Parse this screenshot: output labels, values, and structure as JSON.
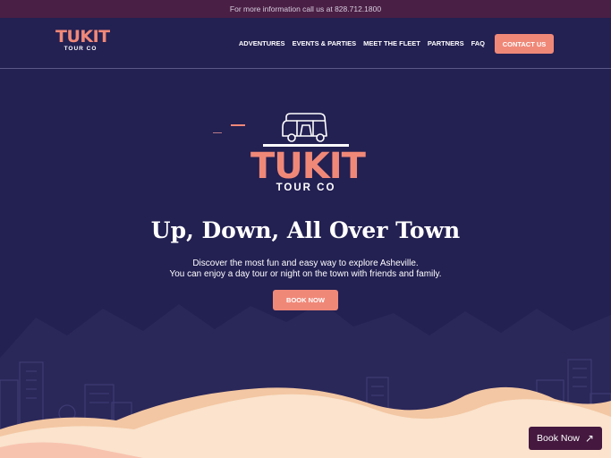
{
  "topbar": {
    "text": "For more information call us at 828.712.1800"
  },
  "header": {
    "logo": {
      "word": "TUKIT",
      "sub": "TOUR CO"
    },
    "nav": [
      {
        "label": "ADVENTURES"
      },
      {
        "label": "EVENTS & PARTIES"
      },
      {
        "label": "MEET THE FLEET"
      },
      {
        "label": "PARTNERS"
      },
      {
        "label": "FAQ"
      }
    ],
    "contact_label": "CONTACT US"
  },
  "hero": {
    "logo": {
      "word": "TUKIT",
      "sub": "TOUR CO"
    },
    "headline": "Up, Down, All Over Town",
    "description_line1": "Discover the most fun and easy way to explore Asheville.",
    "description_line2": "You can enjoy a day tour or night on the town with friends and family.",
    "book_label": "BOOK NOW"
  },
  "floating": {
    "label": "Book Now",
    "icon": "arrow-up-right-icon"
  },
  "colors": {
    "background": "#232052",
    "topbar": "#4a1f45",
    "accent": "#f08878",
    "floating_button": "#44183f",
    "sand_light": "#fbe3cd",
    "sand_dark": "#f3c7a3"
  }
}
